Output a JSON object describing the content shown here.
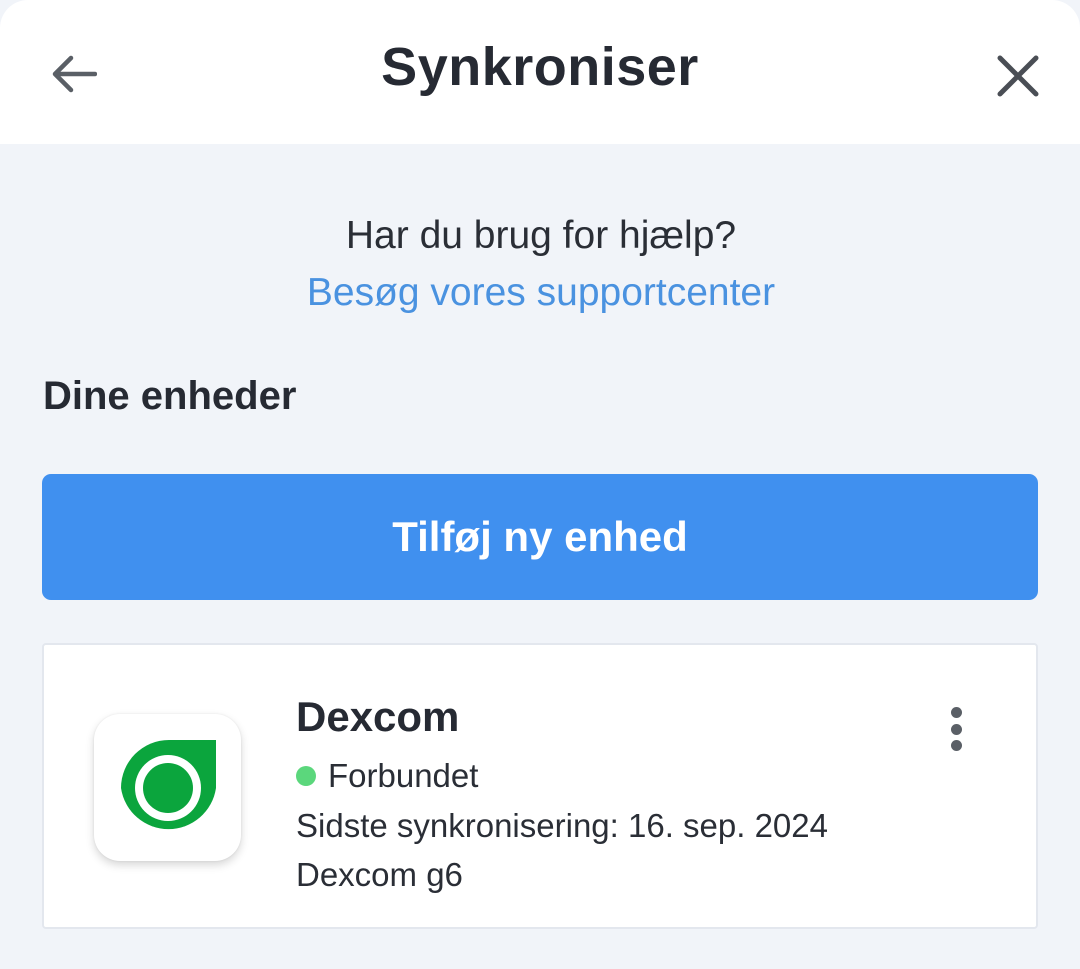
{
  "header": {
    "title": "Synkroniser",
    "back_icon": "arrow-left-icon",
    "close_icon": "close-icon"
  },
  "help": {
    "question": "Har du brug for hjælp?",
    "link_label": "Besøg vores supportcenter",
    "link_color": "#4a92e0"
  },
  "devices": {
    "section_title": "Dine enheder",
    "add_button_label": "Tilføj ny enhed",
    "add_button_color": "#4090ef",
    "items": [
      {
        "name": "Dexcom",
        "logo_icon": "dexcom-logo-icon",
        "status": "Forbundet",
        "status_color": "#5bd77c",
        "last_sync": "Sidste synkronisering: 16. sep. 2024",
        "model": "Dexcom g6",
        "menu_icon": "more-vertical-icon"
      }
    ]
  }
}
